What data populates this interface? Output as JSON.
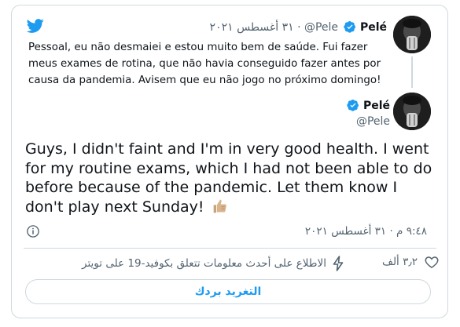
{
  "quoted_tweet": {
    "name": "Pelé",
    "handle": "@Pele",
    "separator": "·",
    "date": "٣١ أغسطس ٢٠٢١",
    "text": "Pessoal, eu não desmaiei e estou muito bem de saúde. Fui fazer meus exames de rotina, que não havia conseguido fazer antes por causa da pandemia. Avisem que eu não jogo no próximo domingo!"
  },
  "main_tweet": {
    "name": "Pelé",
    "handle": "@Pele",
    "text": "Guys, I didn't faint and I'm in very good health. I went for my routine exams, which I had not been able to do before because of the pandemic. Let them know I don't play next Sunday!",
    "timestamp": "٩:٤٨ م · ٣١ أغسطس ٢٠٢١"
  },
  "actions": {
    "like_count": "٣٫٢ ألف",
    "covid_link": "الاطلاع على أحدث معلومات تتعلق بكوفيد-19 على تويتر"
  },
  "reply_button_label": "التغريد بردك",
  "colors": {
    "brand_blue": "#1d9bf0",
    "text": "#0f1419",
    "muted": "#536471",
    "border": "#cfd9de"
  },
  "icons": [
    "twitter-logo-icon",
    "verified-badge-icon",
    "thumbs-up-emoji",
    "info-icon",
    "heart-icon",
    "lightning-bolt-icon"
  ]
}
